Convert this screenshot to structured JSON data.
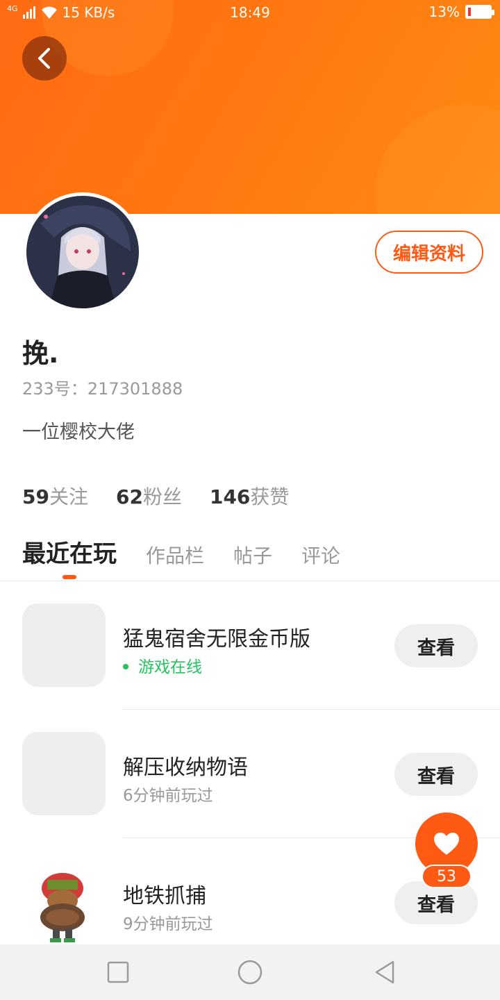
{
  "status_bar": {
    "network": "4G",
    "speed": "15 KB/s",
    "time": "18:49",
    "battery_percent": "13%",
    "battery_level": 0.13,
    "battery_color": "#e53935"
  },
  "profile": {
    "avatar_icon": "anime-avatar",
    "edit_label": "编辑资料",
    "name": "挽.",
    "id_text": "233号：217301888",
    "bio": "一位樱校大佬"
  },
  "stats": [
    {
      "num": "59",
      "label": "关注"
    },
    {
      "num": "62",
      "label": "粉丝"
    },
    {
      "num": "146",
      "label": "获赞"
    }
  ],
  "tabs": [
    {
      "label": "最近在玩",
      "active": true
    },
    {
      "label": "作品栏",
      "active": false
    },
    {
      "label": "帖子",
      "active": false
    },
    {
      "label": "评论",
      "active": false
    }
  ],
  "games": [
    {
      "title": "猛鬼宿舍无限金币版",
      "status": "游戏在线",
      "online": true,
      "button": "查看"
    },
    {
      "title": "解压收纳物语",
      "status": "6分钟前玩过",
      "online": false,
      "button": "查看"
    },
    {
      "title": "地铁抓捕",
      "status": "9分钟前玩过",
      "online": false,
      "button": "查看"
    }
  ],
  "like_fab": {
    "count": "53",
    "icon": "heart-icon"
  },
  "colors": {
    "accent": "#ff5a14",
    "online": "#23c55e",
    "banner": "#ff7a10"
  }
}
